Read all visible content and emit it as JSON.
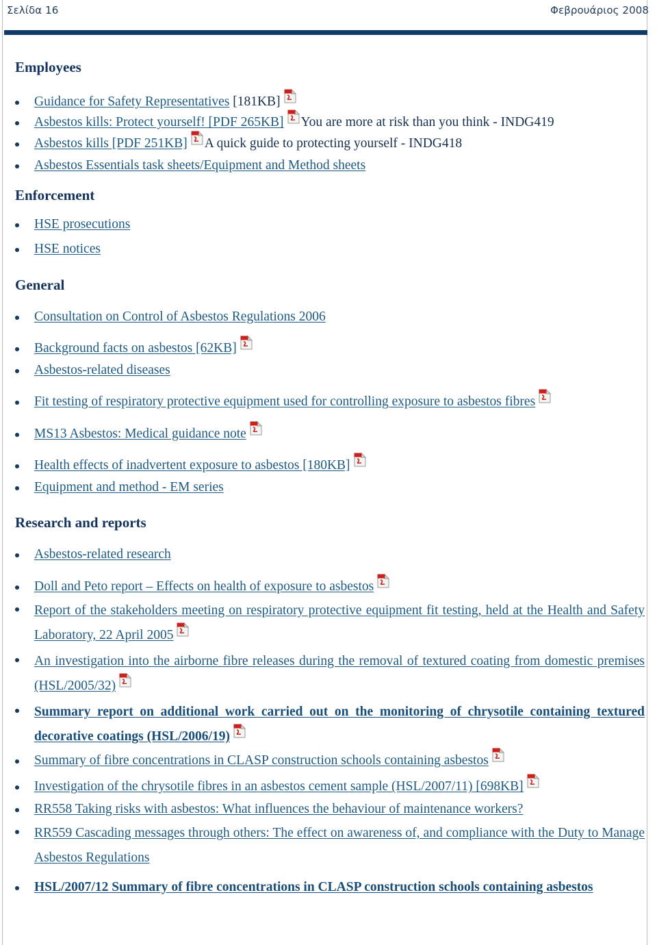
{
  "header": {
    "page_label": "Σελίδα 16",
    "date_label": "Φεβρουάριος 2008"
  },
  "colors": {
    "heading": "#14335c",
    "link": "#1d5a82",
    "rule": "#123a68",
    "bullet": "#15395f",
    "pdf_icon_red": "#c9211e"
  },
  "icons": {
    "pdf": "pdf-icon"
  },
  "sections": [
    {
      "id": "employees",
      "heading": "Employees",
      "items": [
        {
          "link": "Guidance for Safety Representatives",
          "suffix": " [181KB]",
          "pdf": true,
          "trailing": ""
        },
        {
          "link": "Asbestos kills: Protect yourself! [PDF 265KB]",
          "suffix": "",
          "pdf": true,
          "trailing": "You are more at risk than you think - INDG419"
        },
        {
          "link": "Asbestos kills [PDF 251KB]",
          "suffix": "",
          "pdf": true,
          "trailing": "A quick guide to protecting yourself - INDG418"
        },
        {
          "link": "Asbestos Essentials task sheets/Equipment and Method sheets",
          "suffix": "",
          "pdf": false,
          "trailing": ""
        }
      ]
    },
    {
      "id": "enforcement",
      "heading": "Enforcement",
      "items": [
        {
          "link": "HSE prosecutions",
          "suffix": "",
          "pdf": false,
          "trailing": ""
        },
        {
          "link": "HSE notices",
          "suffix": "",
          "pdf": false,
          "trailing": ""
        }
      ]
    },
    {
      "id": "general",
      "heading": "General",
      "items": [
        {
          "link": "Consultation on Control of Asbestos Regulations 2006",
          "suffix": "",
          "pdf": false,
          "trailing": ""
        },
        {
          "link": "Background facts on asbestos [62KB]",
          "suffix": "",
          "pdf": true,
          "trailing": ""
        },
        {
          "link": "Asbestos-related diseases",
          "suffix": "",
          "pdf": false,
          "trailing": ""
        },
        {
          "link": "Fit testing of respiratory protective equipment used for controlling exposure to asbestos fibres",
          "suffix": "",
          "pdf": true,
          "trailing": ""
        },
        {
          "link": "MS13 Asbestos: Medical guidance note",
          "suffix": "",
          "pdf": true,
          "trailing": ""
        },
        {
          "link": "Health effects of inadvertent exposure to asbestos [180KB]",
          "suffix": "",
          "pdf": true,
          "trailing": ""
        },
        {
          "link": "Equipment and method - EM series",
          "suffix": "",
          "pdf": false,
          "trailing": ""
        }
      ]
    },
    {
      "id": "research-and-reports",
      "heading": "Research and reports",
      "items": [
        {
          "link": "Asbestos-related research",
          "suffix": "",
          "pdf": false,
          "trailing": "",
          "bold": false
        },
        {
          "link": "Doll and Peto report – Effects on health of exposure to asbestos",
          "suffix": "",
          "pdf": true,
          "trailing": "",
          "bold": false
        },
        {
          "link": "Report of the stakeholders meeting on respiratory protective equipment fit testing, held at the Health and Safety Laboratory, 22 April 2005",
          "suffix": "",
          "pdf": true,
          "trailing": "",
          "bold": false
        },
        {
          "link": "An investigation into the airborne fibre releases during the removal of textured coating from domestic premises (HSL/2005/32)",
          "suffix": "",
          "pdf": true,
          "trailing": "",
          "bold": false
        },
        {
          "link": "Summary report on additional work carried out on the monitoring of chrysotile containing textured decorative coatings (HSL/2006/19)",
          "suffix": "",
          "pdf": true,
          "trailing": "",
          "bold": true
        },
        {
          "link": "Summary of fibre concentrations in CLASP construction schools containing asbestos",
          "suffix": "",
          "pdf": true,
          "trailing": "",
          "bold": false
        },
        {
          "link": "Investigation of the chrysotile fibres in an asbestos cement sample (HSL/2007/11) [698KB]",
          "suffix": "",
          "pdf": true,
          "trailing": "",
          "bold": false
        },
        {
          "link": "RR558 Taking risks with asbestos: What influences the behaviour of maintenance workers?",
          "suffix": "",
          "pdf": false,
          "trailing": "",
          "bold": false
        },
        {
          "link": "RR559 Cascading messages through others: The effect on awareness of, and compliance with the Duty to Manage Asbestos Regulations",
          "suffix": "",
          "pdf": false,
          "trailing": "",
          "bold": false
        },
        {
          "link": "HSL/2007/12 Summary of fibre concentrations in CLASP construction schools containing asbestos",
          "suffix": "",
          "pdf": false,
          "trailing": "",
          "bold": true
        }
      ]
    }
  ]
}
